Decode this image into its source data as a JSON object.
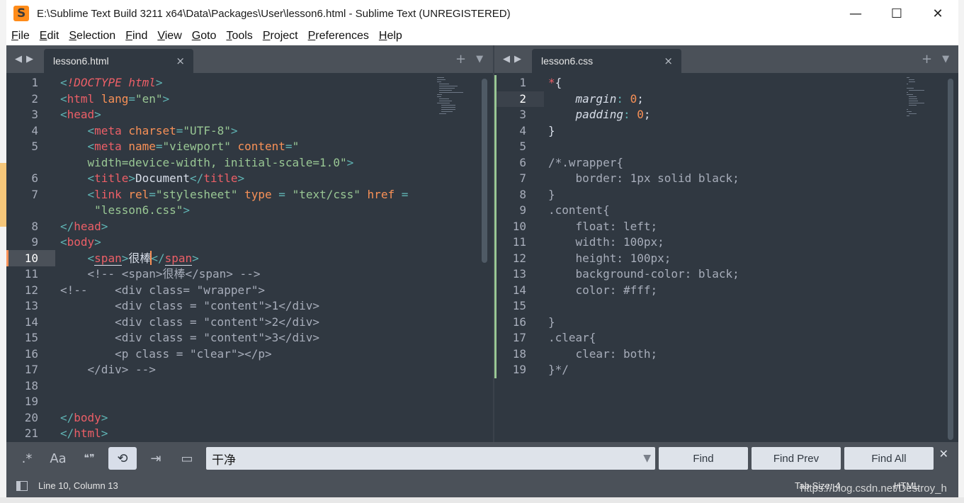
{
  "window": {
    "title": "E:\\Sublime Text Build 3211 x64\\Data\\Packages\\User\\lesson6.html - Sublime Text (UNREGISTERED)",
    "minimize": "—",
    "maximize": "☐",
    "close": "✕"
  },
  "menu": [
    {
      "key": "F",
      "rest": "ile"
    },
    {
      "key": "E",
      "rest": "dit"
    },
    {
      "key": "S",
      "rest": "election"
    },
    {
      "key": "F",
      "rest": "ind"
    },
    {
      "key": "V",
      "rest": "iew"
    },
    {
      "key": "G",
      "rest": "oto"
    },
    {
      "key": "T",
      "rest": "ools"
    },
    {
      "key": "P",
      "rest": "roject"
    },
    {
      "key": "P",
      "rest": "references"
    },
    {
      "key": "H",
      "rest": "elp"
    }
  ],
  "tabs": {
    "left": {
      "label": "lesson6.html",
      "close": "×"
    },
    "right": {
      "label": "lesson6.css",
      "close": "×"
    },
    "nav_prev": "◀",
    "nav_next": "▶",
    "add": "+",
    "more": "▼"
  },
  "left_editor": {
    "line_numbers": [
      "1",
      "2",
      "3",
      "4",
      "",
      "5",
      "6",
      "7",
      "",
      "8",
      "9",
      "10",
      "11",
      "12",
      "13",
      "14",
      "15",
      "16",
      "17",
      "18",
      "19",
      "20",
      "21"
    ],
    "active_line": "10"
  },
  "right_editor": {
    "line_numbers": [
      "1",
      "2",
      "3",
      "4",
      "5",
      "6",
      "7",
      "8",
      "9",
      "10",
      "11",
      "12",
      "13",
      "14",
      "15",
      "16",
      "17",
      "18",
      "19"
    ],
    "active_line": "2"
  },
  "find": {
    "opt_regex": ".*",
    "opt_case": "Aa",
    "opt_word": "❝❞",
    "opt_wrap": "⟲",
    "opt_insel": "⇥",
    "opt_highlight": "▭",
    "query": "干净",
    "dropdown": "▼",
    "find_label": "Find",
    "find_prev_label": "Find Prev",
    "find_all_label": "Find All",
    "close": "✕"
  },
  "status": {
    "position": "Line 10, Column 13",
    "tab_size": "Tab Size: 4",
    "syntax": "HTML"
  },
  "watermark": "https://blog.csdn.net/Destroy_h",
  "colors": {
    "editor_bg": "#303841",
    "panel_bg": "#4b5159",
    "tag": "#ec5f67",
    "attr": "#f99157",
    "string": "#99c794",
    "punct": "#5fb3b3",
    "text": "#d8dee9",
    "comment": "#a7adba"
  }
}
